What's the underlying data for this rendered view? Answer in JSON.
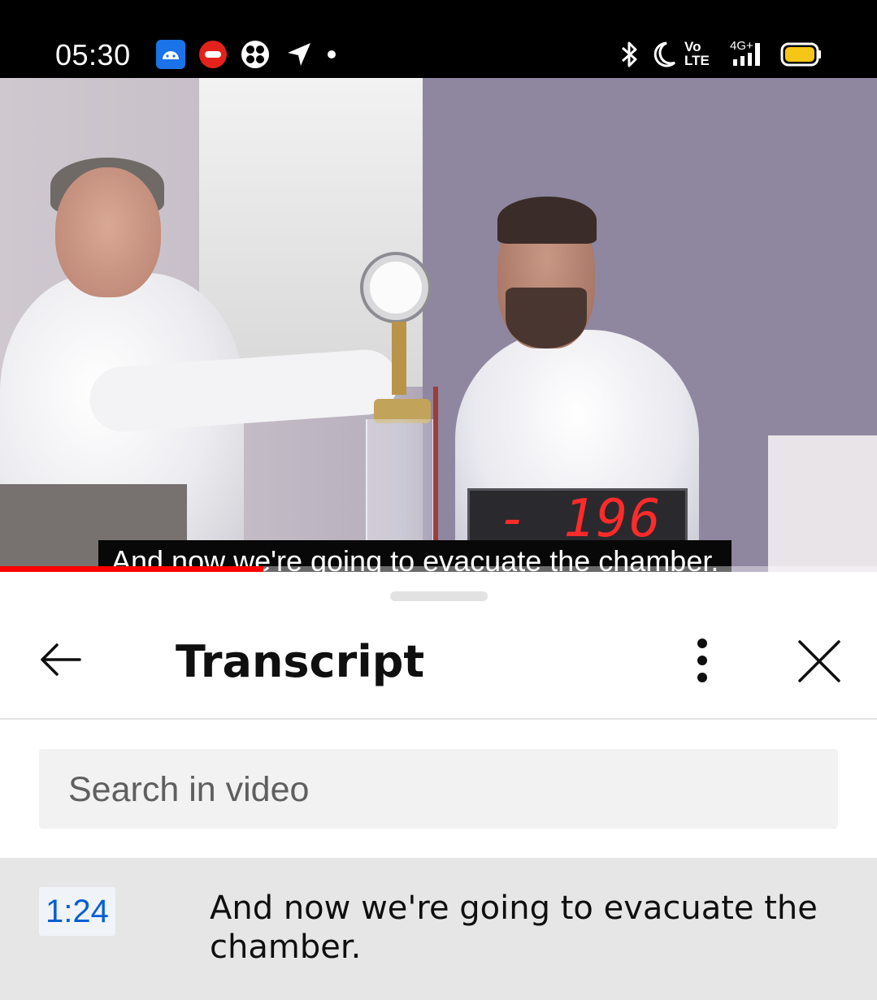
{
  "status_bar": {
    "time": "05:30",
    "left_icons": [
      "android-app-icon",
      "jio-icon",
      "fan-icon",
      "location-arrow-icon",
      "dot-icon"
    ],
    "right_icons": [
      "bluetooth-icon",
      "moon-icon",
      "volte-icon",
      "signal-4g-icon",
      "battery-icon"
    ],
    "volte_label_top": "Vo",
    "volte_label_bottom": "LTE",
    "network_label": "4G+",
    "battery_color": "#f5c518"
  },
  "video": {
    "display_reading": "- 196",
    "caption": "And now we're going to evacuate the chamber.",
    "progress_fraction": 0.3,
    "progress_color": "#ff0000"
  },
  "transcript_panel": {
    "title": "Transcript",
    "back_icon": "arrow-left-icon",
    "more_icon": "more-vert-icon",
    "close_icon": "close-icon",
    "search": {
      "placeholder": "Search in video"
    },
    "segments": [
      {
        "time": "1:24",
        "text": "And now we're going to evacuate the chamber."
      }
    ],
    "accent_color": "#065fd4"
  }
}
